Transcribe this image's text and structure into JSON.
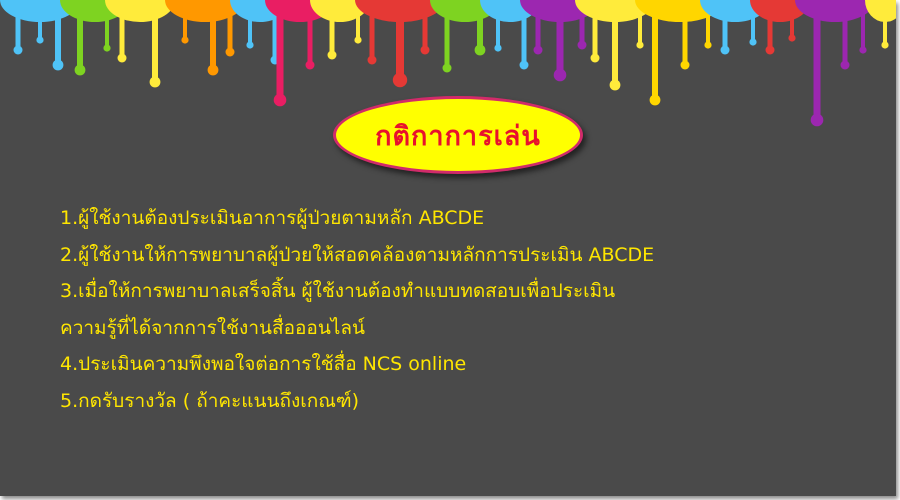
{
  "title": "กติกาการเล่น",
  "rules": [
    "1.ผู้ใช้งานต้องประเมินอาการผู้ป่วยตามหลัก ABCDE",
    "2.ผู้ใช้งานให้การพยาบาลผู้ป่วยให้สอดคล้องตามหลักการประเมิน ABCDE",
    "3.เมื่อให้การพยาบาลเสร็จสิ้น ผู้ใช้งานต้องทำแบบทดสอบเพื่อประเมิน",
    "ความรู้ที่ได้จากการใช้งานสื่อออนไลน์",
    "4.ประเมินความพึงพอใจต่อการใช้สื่อ NCS online",
    "5.กดรับรางวัล ( ถ้าคะแนนถึงเกณฑ์)"
  ],
  "colors": {
    "background": "#4a4a4a",
    "title_oval": "#ffff00",
    "title_border": "#d12b6a",
    "title_text": "#e8112d",
    "rule_text": "#ffe600",
    "paint": [
      "#4fc3f7",
      "#7ed321",
      "#ffeb3b",
      "#ff9800",
      "#e91e63",
      "#e53935",
      "#9c27b0",
      "#ffd600"
    ]
  }
}
